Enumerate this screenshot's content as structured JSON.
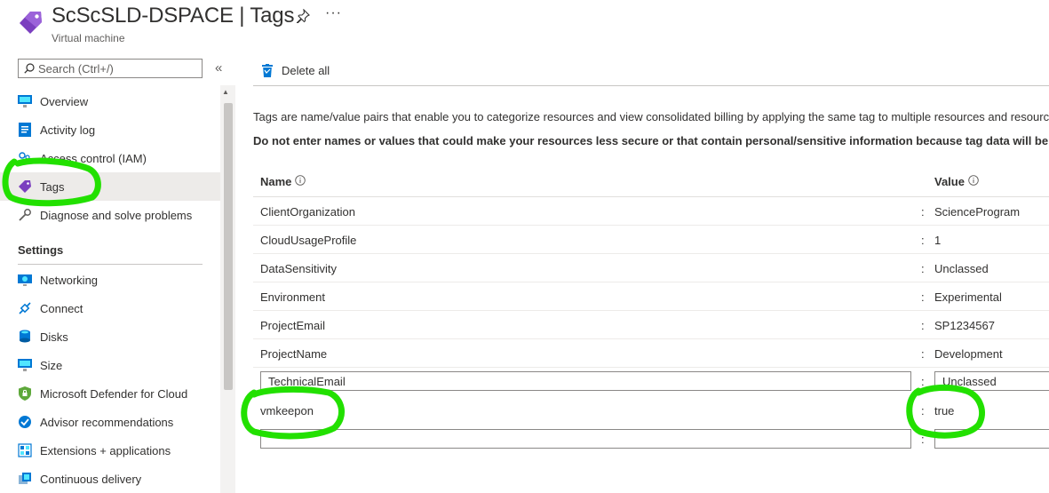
{
  "header": {
    "title": "ScScSLD-DSPACE | Tags",
    "subtitle": "Virtual machine",
    "more": "···",
    "accent_color": "#7b3fbf"
  },
  "search": {
    "placeholder": "Search (Ctrl+/)",
    "collapse": "«"
  },
  "sidebar": {
    "items": [
      {
        "label": "Overview",
        "icon": "overview-icon"
      },
      {
        "label": "Activity log",
        "icon": "activity-log-icon"
      },
      {
        "label": "Access control (IAM)",
        "icon": "access-control-icon"
      },
      {
        "label": "Tags",
        "icon": "tag-icon",
        "selected": true
      },
      {
        "label": "Diagnose and solve problems",
        "icon": "wrench-icon"
      }
    ],
    "section_settings": "Settings",
    "settings_items": [
      {
        "label": "Networking",
        "icon": "networking-icon"
      },
      {
        "label": "Connect",
        "icon": "connect-icon"
      },
      {
        "label": "Disks",
        "icon": "disks-icon"
      },
      {
        "label": "Size",
        "icon": "size-icon"
      },
      {
        "label": "Microsoft Defender for Cloud",
        "icon": "defender-icon"
      },
      {
        "label": "Advisor recommendations",
        "icon": "advisor-icon"
      },
      {
        "label": "Extensions + applications",
        "icon": "extensions-icon"
      },
      {
        "label": "Continuous delivery",
        "icon": "continuous-delivery-icon"
      }
    ]
  },
  "toolbar": {
    "delete_all": "Delete all"
  },
  "main": {
    "description": "Tags are name/value pairs that enable you to categorize resources and view consolidated billing by applying the same tag to multiple resources and resource",
    "warning": "Do not enter names or values that could make your resources less secure or that contain personal/sensitive information because tag data will be replicat",
    "col_name": "Name",
    "col_value": "Value",
    "colon": ":",
    "tags": [
      {
        "name": "ClientOrganization",
        "value": "ScienceProgram"
      },
      {
        "name": "CloudUsageProfile",
        "value": "1"
      },
      {
        "name": "DataSensitivity",
        "value": "Unclassed"
      },
      {
        "name": "Environment",
        "value": "Experimental"
      },
      {
        "name": "ProjectEmail",
        "value": "SP1234567"
      },
      {
        "name": "ProjectName",
        "value": "Development"
      }
    ],
    "edit_rows": [
      {
        "name": "TechnicalEmail",
        "value": "Unclassed"
      },
      {
        "name": "vmkeepon",
        "value": "true"
      },
      {
        "name": "",
        "value": ""
      }
    ]
  }
}
